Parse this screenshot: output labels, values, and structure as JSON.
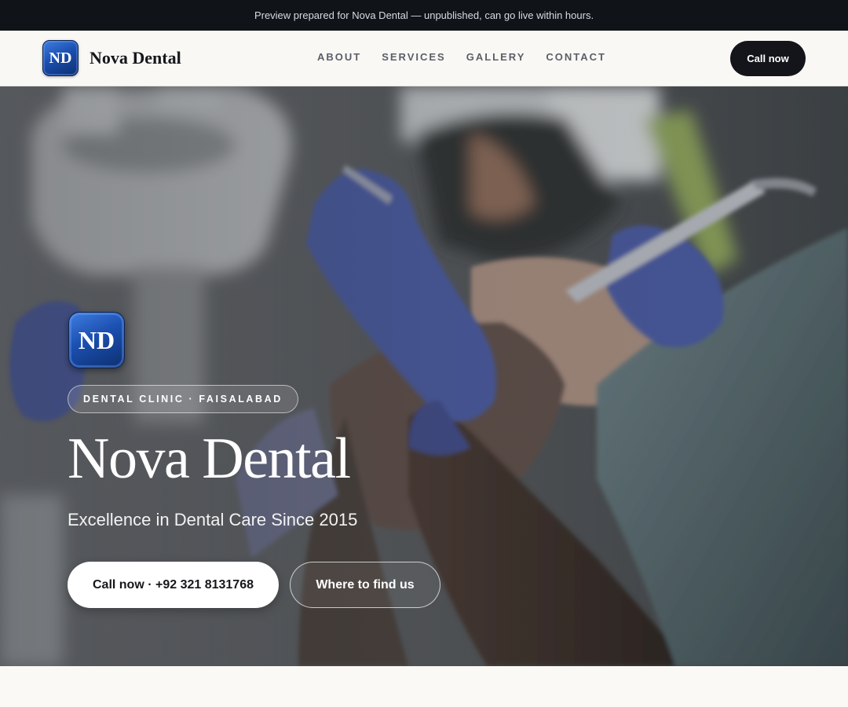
{
  "preview_banner": "Preview prepared for Nova Dental — unpublished, can go live within hours.",
  "header": {
    "logo_text": "ND",
    "brand_name": "Nova Dental",
    "nav": [
      {
        "label": "ABOUT"
      },
      {
        "label": "SERVICES"
      },
      {
        "label": "GALLERY"
      },
      {
        "label": "CONTACT"
      }
    ],
    "call_button": "Call now"
  },
  "hero": {
    "logo_text": "ND",
    "tagline": "DENTAL CLINIC · FAISALABAD",
    "title": "Nova Dental",
    "subtitle": "Excellence in Dental Care Since 2015",
    "primary_button": "Call now · +92 321 8131768",
    "secondary_button": "Where to find us",
    "background_description_icon": "dentist-treating-patient-photo"
  },
  "colors": {
    "topbar": "#101318",
    "nav_bg": "#f9f8f5",
    "call_button": "#13151a",
    "logo_blue": "#1b4fb0",
    "glove_blue": "#4a5aa0"
  }
}
